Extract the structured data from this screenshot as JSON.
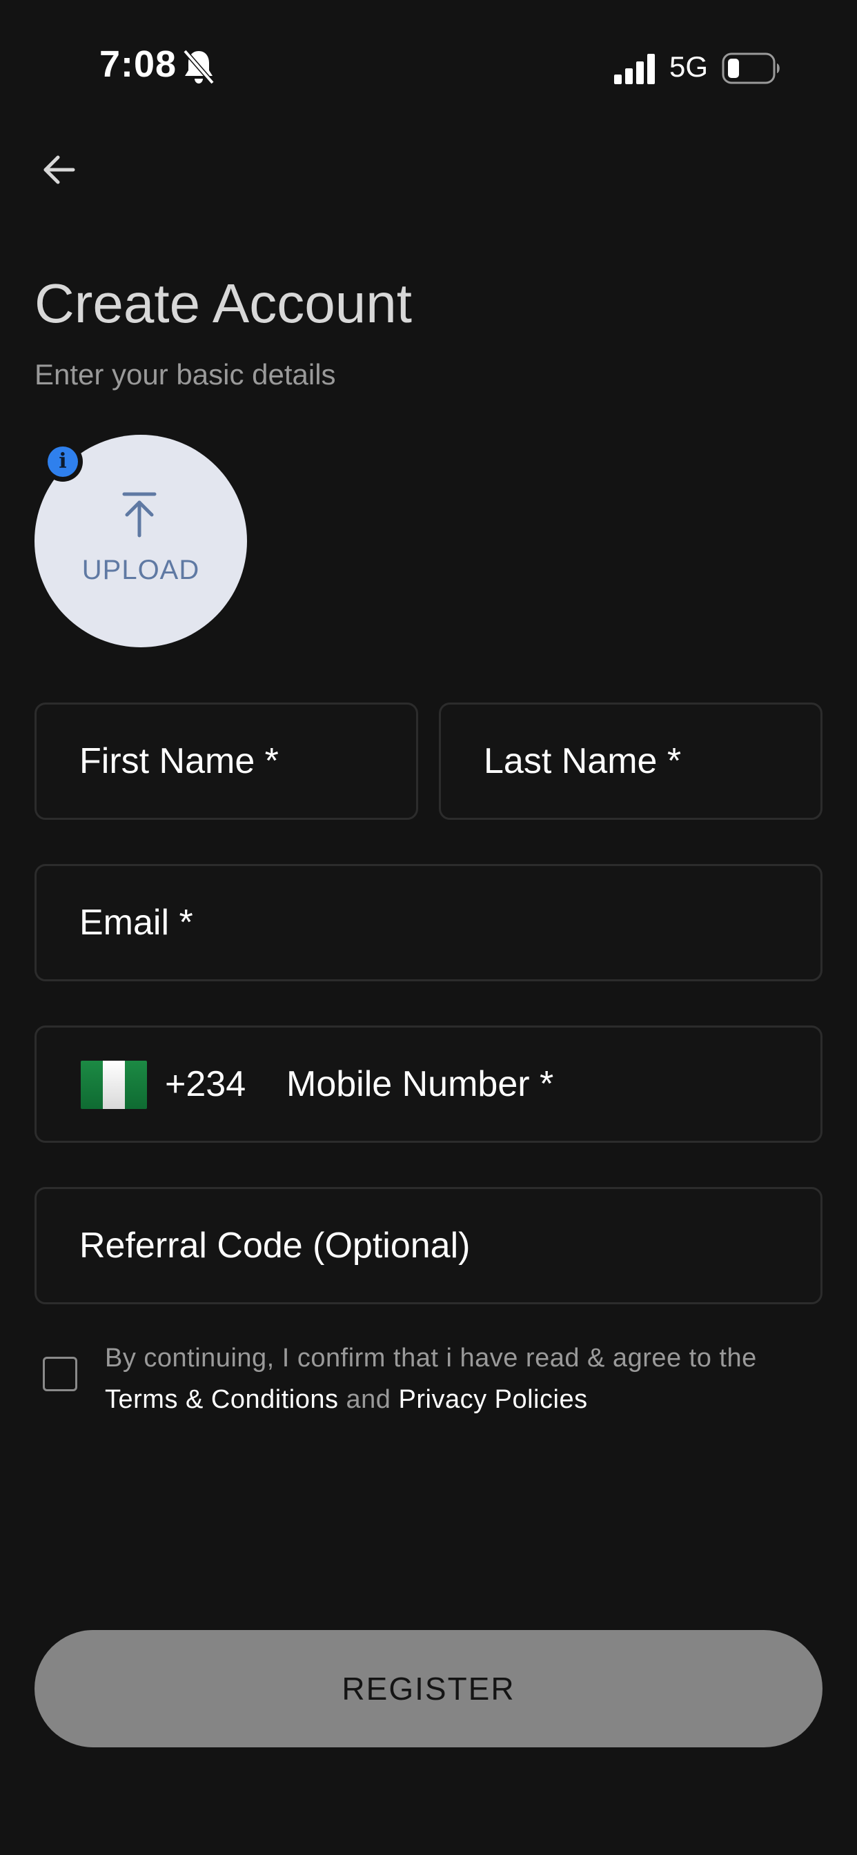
{
  "status_bar": {
    "time": "7:08",
    "network": "5G",
    "icons": [
      "bell-off-icon",
      "signal-icon",
      "battery-icon"
    ]
  },
  "header": {
    "back_icon": "arrow-left-icon",
    "title": "Create Account",
    "subtitle": "Enter your basic details"
  },
  "avatar_upload": {
    "label": "UPLOAD",
    "icon": "upload-arrow-icon",
    "badge_icon": "info-icon",
    "badge_text": "i"
  },
  "form": {
    "first_name": {
      "placeholder": "First Name *",
      "value": ""
    },
    "last_name": {
      "placeholder": "Last Name *",
      "value": ""
    },
    "email": {
      "placeholder": "Email *",
      "value": ""
    },
    "mobile": {
      "flag_icon": "nigeria-flag-icon",
      "dial_code": "+234",
      "placeholder": "Mobile Number *",
      "value": ""
    },
    "referral": {
      "placeholder": "Referral Code (Optional)",
      "value": ""
    }
  },
  "terms": {
    "checked": false,
    "text_before": "By continuing, I confirm that i have read & agree to the ",
    "terms_link": "Terms & Conditions",
    "text_middle": " and ",
    "privacy_link": "Privacy Policies"
  },
  "register_button": {
    "label": "REGISTER"
  },
  "colors": {
    "background": "#131313",
    "field_border": "#2c2c2c",
    "avatar_bg": "#e3e6ef",
    "avatar_accent": "#5f79a3",
    "info_blue": "#2f80ed",
    "button_disabled": "#858585",
    "muted_text": "#9a9a9a"
  }
}
